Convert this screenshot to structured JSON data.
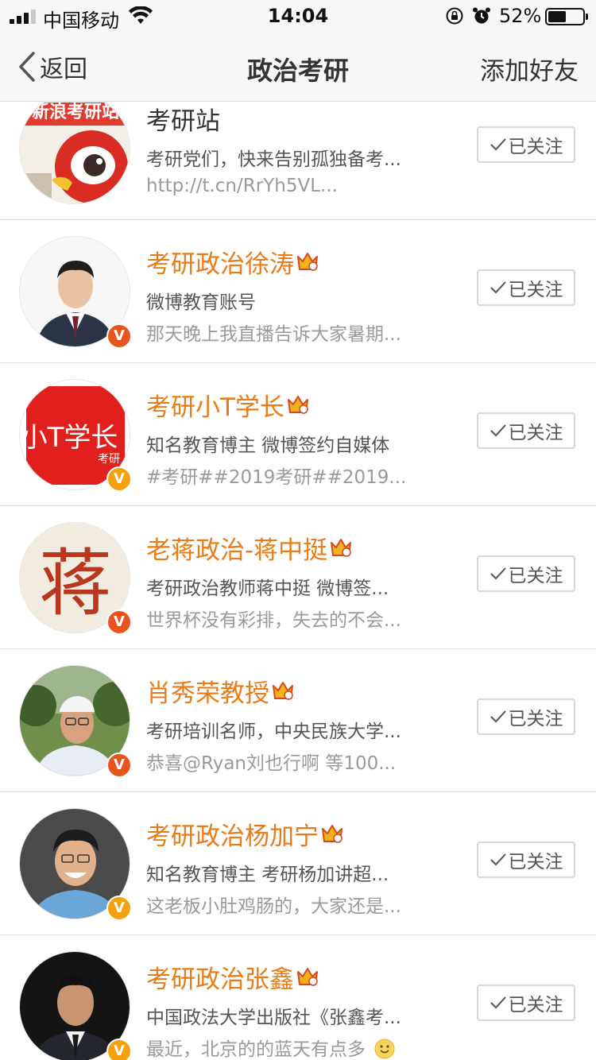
{
  "status_bar": {
    "carrier": "中国移动",
    "time": "14:04",
    "battery_percent": "52%",
    "battery_level": 0.52
  },
  "nav": {
    "back_label": "返回",
    "title": "政治考研",
    "add_friend_label": "添加好友"
  },
  "follow_label": "已关注",
  "accounts": [
    {
      "name": "考研站",
      "description": "考研党们，快来告别孤独备考...",
      "latest": "http://t.cn/RrYh5VL...",
      "vip": false,
      "badge": "none",
      "avatar_text": "新浪考研站"
    },
    {
      "name": "考研政治徐涛",
      "description": "微博教育账号",
      "latest": "那天晚上我直播告诉大家暑期...",
      "vip": true,
      "badge": "red"
    },
    {
      "name": "考研小T学长",
      "description": "知名教育博主 微博签约自媒体",
      "latest": "#考研##2019考研##2019...",
      "vip": true,
      "badge": "orange",
      "avatar_text_main": "小T学长",
      "avatar_text_small": "考研"
    },
    {
      "name": "老蒋政治-蒋中挺",
      "description": "考研政治教师蒋中挺 微博签...",
      "latest": "世界杯没有彩排，失去的不会...",
      "vip": true,
      "badge": "red",
      "avatar_text": "蒋"
    },
    {
      "name": "肖秀荣教授",
      "description": "考研培训名师，中央民族大学...",
      "latest": "恭喜@Ryan刘也行啊 等100...",
      "vip": true,
      "badge": "red"
    },
    {
      "name": "考研政治杨加宁",
      "description": "知名教育博主 考研杨加讲超...",
      "latest": "这老板小肚鸡肠的，大家还是...",
      "vip": true,
      "badge": "orange"
    },
    {
      "name": "考研政治张鑫",
      "description": "中国政法大学出版社《张鑫考...",
      "latest": "最近，北京的的蓝天有点多",
      "latest_emoji": "smile-emoji",
      "vip": true,
      "badge": "orange"
    }
  ],
  "colors": {
    "vip_name": "#eb7b18",
    "badge_red": "#e8541d",
    "badge_orange": "#f3a20d",
    "nav_bg": "#f7f7f7"
  }
}
